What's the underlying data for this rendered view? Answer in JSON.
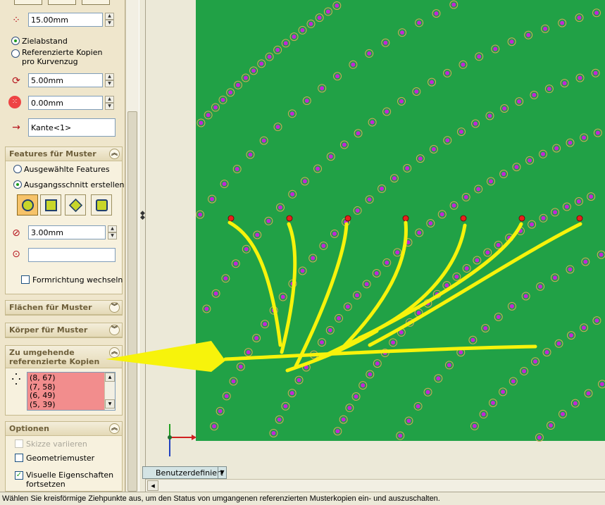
{
  "pattern": {
    "spacing_value": "15.00mm",
    "radio_target_distance": "Zielabstand",
    "radio_referenced_copies": "Referenzierte Kopien pro Kurvenzug",
    "offset_value": "5.00mm",
    "offset2_value": "0.00mm",
    "edge_value": "Kante<1>"
  },
  "features": {
    "title": "Features für Muster",
    "radio_selected": "Ausgewählte Features",
    "radio_cut": "Ausgangsschnitt erstellen",
    "diameter_value": "3.00mm",
    "empty_value": "",
    "flip_label": "Formrichtung wechseln"
  },
  "faces": {
    "title": "Flächen für Muster"
  },
  "bodies": {
    "title": "Körper für Muster"
  },
  "skip": {
    "title_line1": "Zu umgehende",
    "title_line2": "referenzierte Kopien",
    "items": [
      "(8, 67)",
      "(7, 58)",
      "(6, 49)",
      "(5, 39)"
    ]
  },
  "options": {
    "title": "Optionen",
    "vary_sketch": "Skizze variieren",
    "geometry": "Geometriemuster",
    "visual_line1": "Visuelle Eigenschaften",
    "visual_line2": "fortsetzen"
  },
  "viewport": {
    "view_tab": "Benutzerdefiniert",
    "colors": {
      "background": "#21a146",
      "hole_fill": "#c426d6",
      "hole_ring": "#d2a75a",
      "annotation": "#f7f30b",
      "seed": "#e8201d"
    }
  },
  "statusbar": {
    "text": "Wählen Sie kreisförmige Ziehpunkte aus, um den Status von umgangenen referenzierten Musterkopien ein- und auszuschalten."
  }
}
